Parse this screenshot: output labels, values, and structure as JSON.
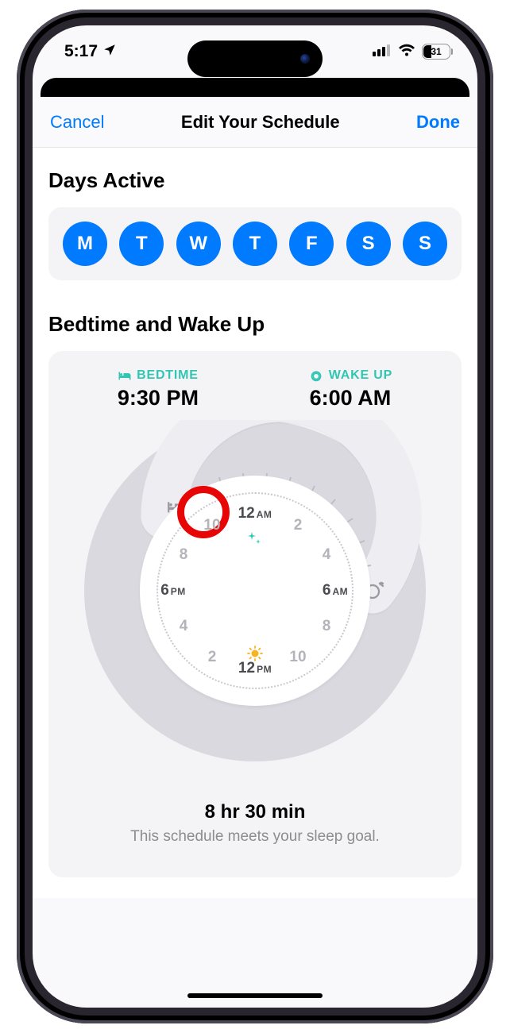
{
  "status": {
    "time": "5:17",
    "battery": "31"
  },
  "nav": {
    "cancel": "Cancel",
    "title": "Edit Your Schedule",
    "done": "Done"
  },
  "sections": {
    "days_title": "Days Active",
    "bed_title": "Bedtime and Wake Up"
  },
  "days": [
    "M",
    "T",
    "W",
    "T",
    "F",
    "S",
    "S"
  ],
  "bed": {
    "bedtime_label": "BEDTIME",
    "bedtime_value": "9:30 PM",
    "wake_label": "WAKE UP",
    "wake_value": "6:00 AM"
  },
  "clock": {
    "h12am": "12",
    "am": "AM",
    "h2": "2",
    "h4": "4",
    "h6am": "6",
    "h8": "8",
    "h10": "10",
    "h12pm": "12",
    "pm": "PM",
    "h6pm": "6"
  },
  "summary": {
    "duration": "8 hr 30 min",
    "note": "This schedule meets your sleep goal."
  }
}
